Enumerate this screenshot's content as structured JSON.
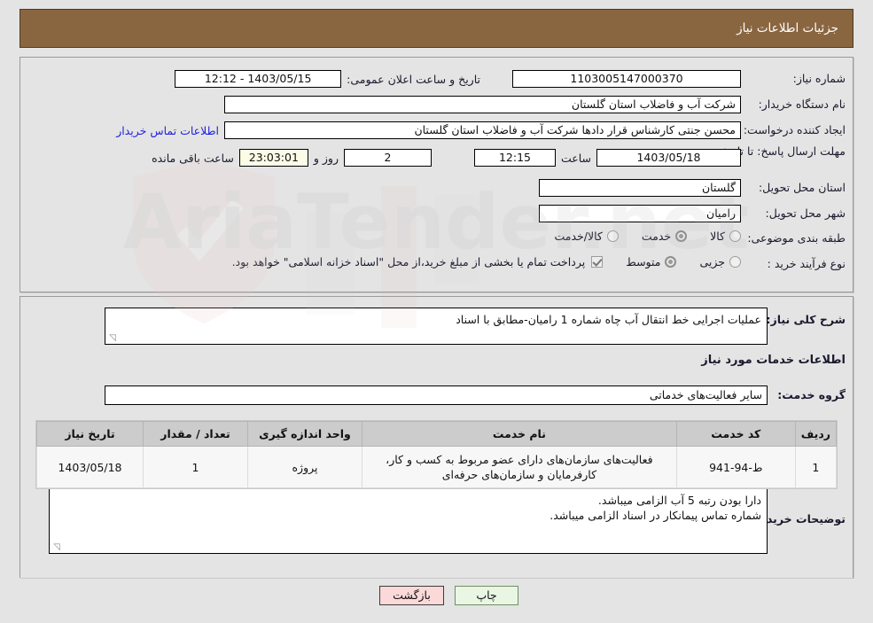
{
  "header": {
    "title": "جزئیات اطلاعات نیاز"
  },
  "fields": {
    "need_number_label": "شماره نیاز:",
    "need_number_value": "1103005147000370",
    "announce_label": "تاریخ و ساعت اعلان عمومی:",
    "announce_value": "1403/05/15 - 12:12",
    "buyer_org_label": "نام دستگاه خریدار:",
    "buyer_org_value": "شرکت آب و فاضلاب استان گلستان",
    "creator_label": "ایجاد کننده درخواست:",
    "creator_value": "محسن جنتی کارشناس قرار دادها شرکت آب و فاضلاب استان گلستان",
    "contact_link": "اطلاعات تماس خریدار",
    "deadline_label": "مهلت ارسال پاسخ: تا تاریخ:",
    "deadline_date": "1403/05/18",
    "hour_label": "ساعت",
    "deadline_time": "12:15",
    "days_left": "2",
    "days_word": "روز و",
    "time_left": "23:03:01",
    "remaining_word": "ساعت باقی مانده",
    "province_label": "استان محل تحویل:",
    "province_value": "گلستان",
    "city_label": "شهر محل تحویل:",
    "city_value": "رامیان",
    "category_label": "طبقه بندی موضوعی:",
    "process_label": "نوع فرآیند خرید :"
  },
  "category_options": [
    {
      "label": "کالا",
      "selected": false
    },
    {
      "label": "خدمت",
      "selected": true
    },
    {
      "label": "کالا/خدمت",
      "selected": false
    }
  ],
  "process_options": [
    {
      "label": "جزیی",
      "selected": false
    },
    {
      "label": "متوسط",
      "selected": true
    }
  ],
  "treasury": {
    "checked": true,
    "text": "پرداخت تمام یا بخشی از مبلغ خرید،از محل \"اسناد خزانه اسلامی\" خواهد بود."
  },
  "description": {
    "label": "شرح کلی نیاز:",
    "value": "عملیات اجرایی خط انتقال آب چاه شماره 1 رامیان-مطابق با اسناد"
  },
  "services_section": {
    "heading": "اطلاعات خدمات مورد نیاز",
    "group_label": "گروه خدمت:",
    "group_value": "سایر فعالیت‌های خدماتی"
  },
  "table": {
    "columns": [
      "ردیف",
      "کد خدمت",
      "نام خدمت",
      "واحد اندازه گیری",
      "تعداد / مقدار",
      "تاریخ نیاز"
    ],
    "rows": [
      {
        "row_no": "1",
        "service_code": "ط-94-941",
        "service_name": "فعالیت‌های سازمان‌های دارای عضو مربوط به کسب و کار، کارفرمایان و سازمان‌های حرفه‌ای",
        "unit": "پروژه",
        "quantity": "1",
        "need_date": "1403/05/18"
      }
    ]
  },
  "buyer_notes": {
    "label": "توضیحات خریدار:",
    "line1": "دارا بودن رتبه 5 آب الزامی میباشد.",
    "line2": "شماره تماس پیمانکار در اسناد الزامی میباشد."
  },
  "buttons": {
    "print": "چاپ",
    "back": "بازگشت"
  },
  "watermark": {
    "text": "AriaTender.net"
  },
  "colors": {
    "header_bg": "#8a6640",
    "link": "#2222dd",
    "highlight_field": "#fbfbe6"
  }
}
